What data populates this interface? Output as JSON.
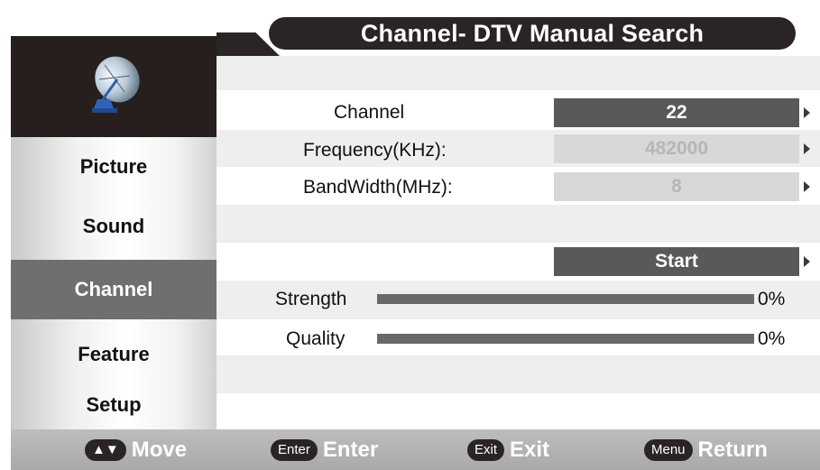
{
  "title": "Channel- DTV  Manual Search",
  "sidebar": {
    "icon": "satellite-dish-icon",
    "items": [
      {
        "label": "Picture"
      },
      {
        "label": "Sound"
      },
      {
        "label": "Channel"
      },
      {
        "label": "Feature"
      },
      {
        "label": "Setup"
      }
    ],
    "active": "Channel"
  },
  "fields": {
    "channel": {
      "label": "Channel",
      "value": "22"
    },
    "frequency": {
      "label": "Frequency(KHz):",
      "value": "482000"
    },
    "bandwidth": {
      "label": "BandWidth(MHz):",
      "value": "8"
    }
  },
  "start_label": "Start",
  "signal": {
    "strength": {
      "label": "Strength",
      "value": "0%",
      "fraction": 0
    },
    "quality": {
      "label": "Quality",
      "value": "0%",
      "fraction": 0
    }
  },
  "footer": [
    {
      "key": "▲▼",
      "label": "Move"
    },
    {
      "key": "Enter",
      "label": "Enter"
    },
    {
      "key": "Exit",
      "label": "Exit"
    },
    {
      "key": "Menu",
      "label": "Return"
    }
  ],
  "colors": {
    "dark": "#2b2424",
    "selected": "#595959",
    "active_tab": "#6f6f6f",
    "row": "#eeeeee"
  }
}
